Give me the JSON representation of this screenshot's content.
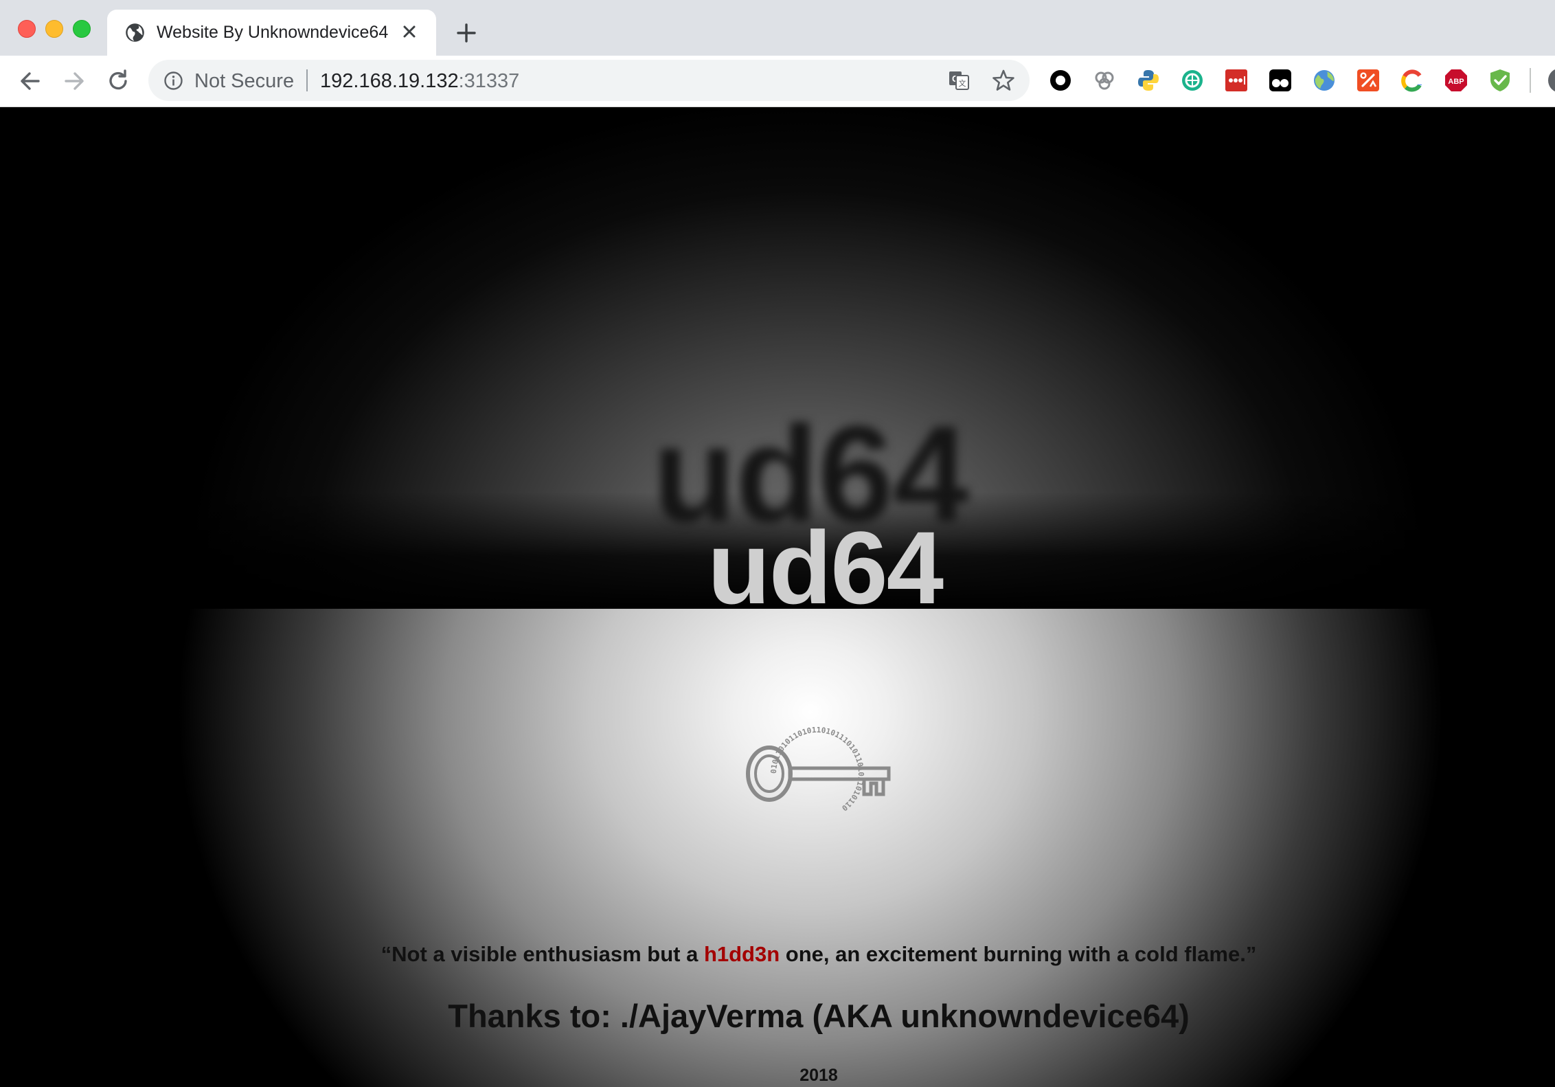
{
  "browser": {
    "tab": {
      "title": "Website By Unknowndevice64",
      "favicon": "globe-icon"
    },
    "address_bar": {
      "security_label": "Not Secure",
      "host": "192.168.19.132",
      "port": ":31337"
    },
    "extensions": [
      "ring-extension-icon",
      "link-extension-icon",
      "python-extension-icon",
      "green-globe-extension-icon",
      "lastpass-extension-icon",
      "tampermonkey-extension-icon",
      "globe-extension-icon",
      "percent-extension-icon",
      "colorful-c-extension-icon",
      "adblock-plus-extension-icon",
      "shield-check-extension-icon"
    ]
  },
  "page": {
    "shadow_title": "ud64",
    "title": "ud64",
    "quote_before": "“Not a visible enthusiasm but a ",
    "quote_highlight": "h1dd3n",
    "quote_after": " one, an excitement burning with a cold flame.”",
    "thanks": "Thanks to: ./AjayVerma (AKA unknowndevice64)",
    "year": "2018",
    "key_binary_text": "0101101011010110101110101101011010110"
  },
  "colors": {
    "tabbar": "#dee1e6",
    "highlight": "#a30000",
    "title": "#cfcfcf"
  }
}
